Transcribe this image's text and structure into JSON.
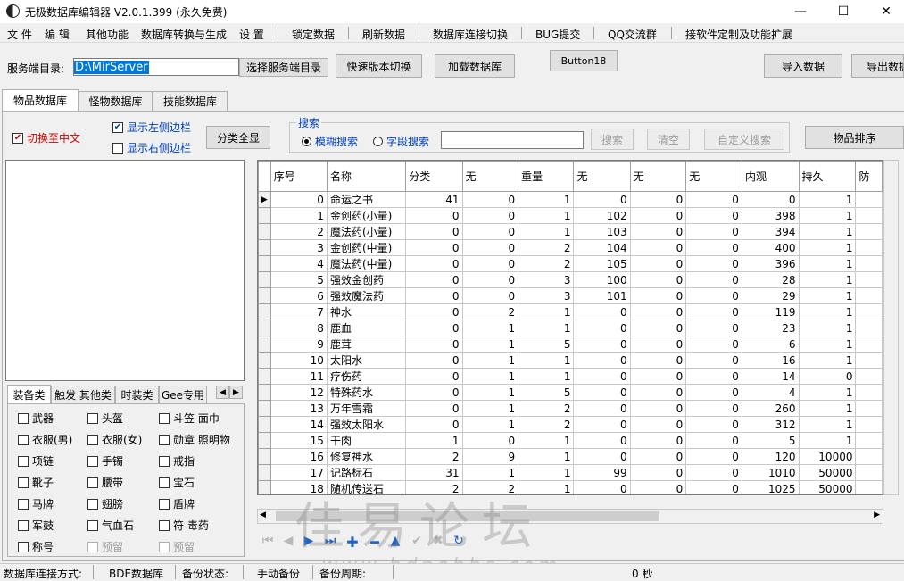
{
  "window": {
    "title": "无极数据库编辑器 V2.0.1.399 (永久免费)",
    "min": "—",
    "max": "☐",
    "close": "✕"
  },
  "menu": [
    "文 件",
    "编 辑",
    "其他功能",
    "数据库转换与生成",
    "设 置",
    "锁定数据",
    "刷新数据",
    "数据库连接切换",
    "BUG提交",
    "QQ交流群",
    "接软件定制及功能扩展"
  ],
  "toolbar": {
    "server_dir_label": "服务端目录:",
    "server_dir_value": "D:\\MirServer",
    "choose_dir": "选择服务端目录",
    "quick_switch": "快速版本切换",
    "load_db": "加载数据库",
    "button18": "Button18",
    "import": "导入数据",
    "export": "导出数据"
  },
  "tabs": [
    "物品数据库",
    "怪物数据库",
    "技能数据库"
  ],
  "options": {
    "switch_chinese": "切换至中文",
    "show_left": "显示左侧边栏",
    "show_right": "显示右侧边栏",
    "show_all": "分类全显"
  },
  "search": {
    "legend": "搜索",
    "fuzzy": "模糊搜索",
    "field": "字段搜索",
    "value": "",
    "search_btn": "搜索",
    "clear_btn": "清空",
    "custom_btn": "自定义搜索",
    "sort_btn": "物品排序"
  },
  "category_tabs": [
    "装备类",
    "触发 其他类",
    "时装类",
    "Gee专用"
  ],
  "categories": [
    [
      "武器",
      "头盔",
      "斗笠 面巾"
    ],
    [
      "衣服(男)",
      "衣服(女)",
      "勋章 照明物"
    ],
    [
      "项链",
      "手镯",
      "戒指"
    ],
    [
      "靴子",
      "腰带",
      "宝石"
    ],
    [
      "马牌",
      "翅膀",
      "盾牌"
    ],
    [
      "军鼓",
      "气血石",
      "符 毒药"
    ],
    [
      "称号",
      "预留",
      "预留"
    ]
  ],
  "grid": {
    "columns": [
      "序号",
      "名称",
      "分类",
      "无",
      "重量",
      "无",
      "无",
      "无",
      "内观",
      "持久",
      "防"
    ],
    "rows": [
      [
        "0",
        "命运之书",
        "41",
        "0",
        "1",
        "0",
        "0",
        "0",
        "0",
        "1"
      ],
      [
        "1",
        "金创药(小量)",
        "0",
        "0",
        "1",
        "102",
        "0",
        "0",
        "398",
        "1"
      ],
      [
        "2",
        "魔法药(小量)",
        "0",
        "0",
        "1",
        "103",
        "0",
        "0",
        "394",
        "1"
      ],
      [
        "3",
        "金创药(中量)",
        "0",
        "0",
        "2",
        "104",
        "0",
        "0",
        "400",
        "1"
      ],
      [
        "4",
        "魔法药(中量)",
        "0",
        "0",
        "2",
        "105",
        "0",
        "0",
        "396",
        "1"
      ],
      [
        "5",
        "强效金创药",
        "0",
        "0",
        "3",
        "100",
        "0",
        "0",
        "28",
        "1"
      ],
      [
        "6",
        "强效魔法药",
        "0",
        "0",
        "3",
        "101",
        "0",
        "0",
        "29",
        "1"
      ],
      [
        "7",
        "神水",
        "0",
        "2",
        "1",
        "0",
        "0",
        "0",
        "119",
        "1"
      ],
      [
        "8",
        "鹿血",
        "0",
        "1",
        "1",
        "0",
        "0",
        "0",
        "23",
        "1"
      ],
      [
        "9",
        "鹿茸",
        "0",
        "1",
        "5",
        "0",
        "0",
        "0",
        "6",
        "1"
      ],
      [
        "10",
        "太阳水",
        "0",
        "1",
        "1",
        "0",
        "0",
        "0",
        "16",
        "1"
      ],
      [
        "11",
        "疗伤药",
        "0",
        "1",
        "1",
        "0",
        "0",
        "0",
        "14",
        "0"
      ],
      [
        "12",
        "特殊药水",
        "0",
        "1",
        "5",
        "0",
        "0",
        "0",
        "4",
        "1"
      ],
      [
        "13",
        "万年雪霜",
        "0",
        "1",
        "2",
        "0",
        "0",
        "0",
        "260",
        "1"
      ],
      [
        "14",
        "强效太阳水",
        "0",
        "1",
        "2",
        "0",
        "0",
        "0",
        "312",
        "1"
      ],
      [
        "15",
        "干肉",
        "1",
        "0",
        "1",
        "0",
        "0",
        "0",
        "5",
        "1"
      ],
      [
        "16",
        "修复神水",
        "2",
        "9",
        "1",
        "0",
        "0",
        "0",
        "120",
        "10000"
      ],
      [
        "17",
        "记路标石",
        "31",
        "1",
        "1",
        "99",
        "0",
        "0",
        "1010",
        "50000"
      ],
      [
        "18",
        "随机传送石",
        "2",
        "2",
        "1",
        "0",
        "0",
        "0",
        "1025",
        "50000"
      ]
    ]
  },
  "status": {
    "conn_label": "数据库连接方式:",
    "conn_value": "BDE数据库",
    "backup_label": "备份状态:",
    "backup_value": "手动备份",
    "period_label": "备份周期:",
    "period_value": "0 秒"
  },
  "watermark": {
    "text": "佳易论坛",
    "url": "www.bdnabbs.com"
  }
}
